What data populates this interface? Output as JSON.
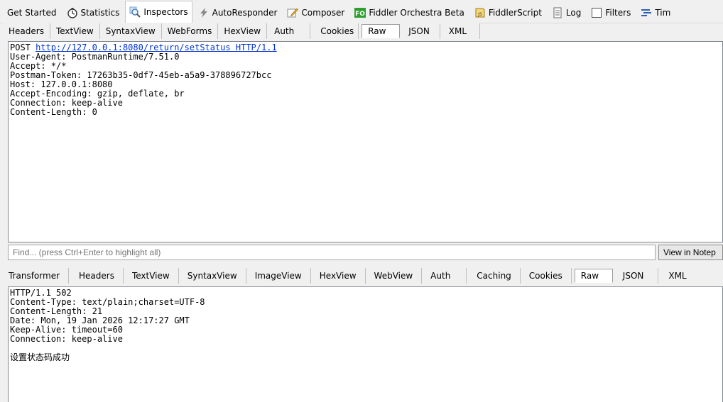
{
  "main_tabs": [
    {
      "label": "Get Started",
      "icon": ""
    },
    {
      "label": "Statistics",
      "icon": "stopwatch-icon"
    },
    {
      "label": "Inspectors",
      "icon": "magnifier-icon",
      "active": true
    },
    {
      "label": "AutoResponder",
      "icon": "lightning-icon"
    },
    {
      "label": "Composer",
      "icon": "pencil-icon"
    },
    {
      "label": "Fiddler Orchestra Beta",
      "icon": "fo-icon"
    },
    {
      "label": "FiddlerScript",
      "icon": "js-icon"
    },
    {
      "label": "Log",
      "icon": "log-icon"
    },
    {
      "label": "Filters",
      "icon": "checkbox-icon"
    },
    {
      "label": "Tim",
      "icon": "timeline-icon"
    }
  ],
  "request_tabs": [
    "Headers",
    "TextView",
    "SyntaxView",
    "WebForms",
    "HexView",
    "Auth",
    "Cookies",
    "Raw",
    "JSON",
    "XML"
  ],
  "request_active": "Raw",
  "request": {
    "method": "POST ",
    "url": "http://127.0.0.1:8080/return/setStatus HTTP/1.1",
    "lines": [
      "User-Agent: PostmanRuntime/7.51.0",
      "Accept: */*",
      "Postman-Token: 17263b35-0df7-45eb-a5a9-378896727bcc",
      "Host: 127.0.0.1:8080",
      "Accept-Encoding: gzip, deflate, br",
      "Connection: keep-alive",
      "Content-Length: 0"
    ]
  },
  "find": {
    "placeholder": "Find... (press Ctrl+Enter to highlight all)",
    "button": "View in Notep"
  },
  "response_tabs": [
    "Transformer",
    "Headers",
    "TextView",
    "SyntaxView",
    "ImageView",
    "HexView",
    "WebView",
    "Auth",
    "Caching",
    "Cookies",
    "Raw",
    "JSON",
    "XML"
  ],
  "response_active": "Raw",
  "response": {
    "lines": [
      "HTTP/1.1 502",
      "Content-Type: text/plain;charset=UTF-8",
      "Content-Length: 21",
      "Date: Mon, 19 Jan 2026 12:17:27 GMT",
      "Keep-Alive: timeout=60",
      "Connection: keep-alive"
    ],
    "body": "设置状态码成功"
  },
  "colors": {
    "link": "#0033cc",
    "fo_badge": "#2e9e2e"
  }
}
